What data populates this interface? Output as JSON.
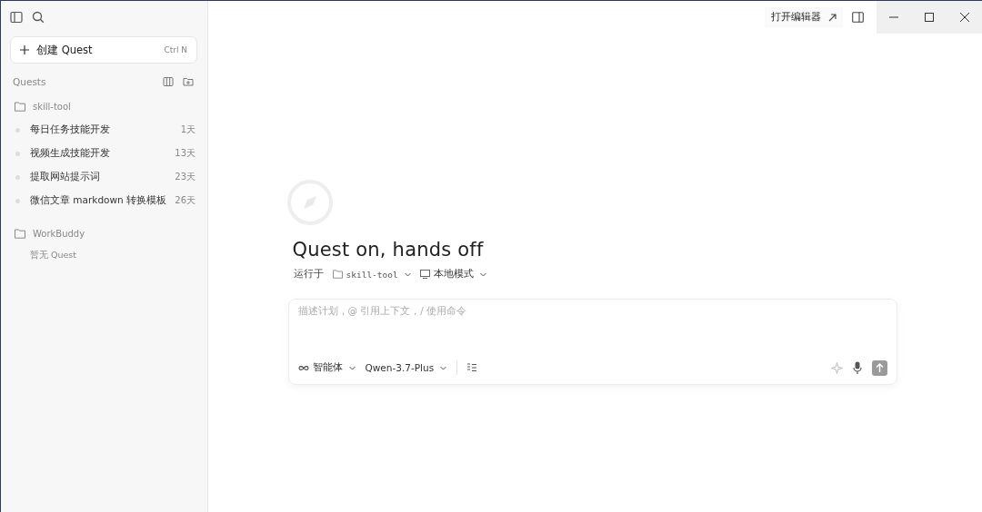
{
  "sidebar": {
    "new_button": {
      "label": "创建 Quest",
      "shortcut": "Ctrl N"
    },
    "section_title": "Quests",
    "folders": [
      {
        "name": "skill-tool",
        "items": [
          {
            "title": "每日任务技能开发",
            "age": "1天"
          },
          {
            "title": "视频生成技能开发",
            "age": "13天"
          },
          {
            "title": "提取网站提示词",
            "age": "23天"
          },
          {
            "title": "微信文章 markdown 转换模板",
            "age": "26天"
          }
        ]
      },
      {
        "name": "WorkBuddy",
        "empty_text": "暂无 Quest"
      }
    ]
  },
  "topbar": {
    "open_editor": "打开编辑器"
  },
  "main": {
    "title": "Quest on, hands off",
    "run_label": "运行于",
    "workspace": "skill-tool",
    "mode": "本地模式",
    "composer": {
      "placeholder": "描述计划，@ 引用上下文，/ 使用命令",
      "agent": "智能体",
      "model": "Qwen-3.7-Plus"
    }
  }
}
